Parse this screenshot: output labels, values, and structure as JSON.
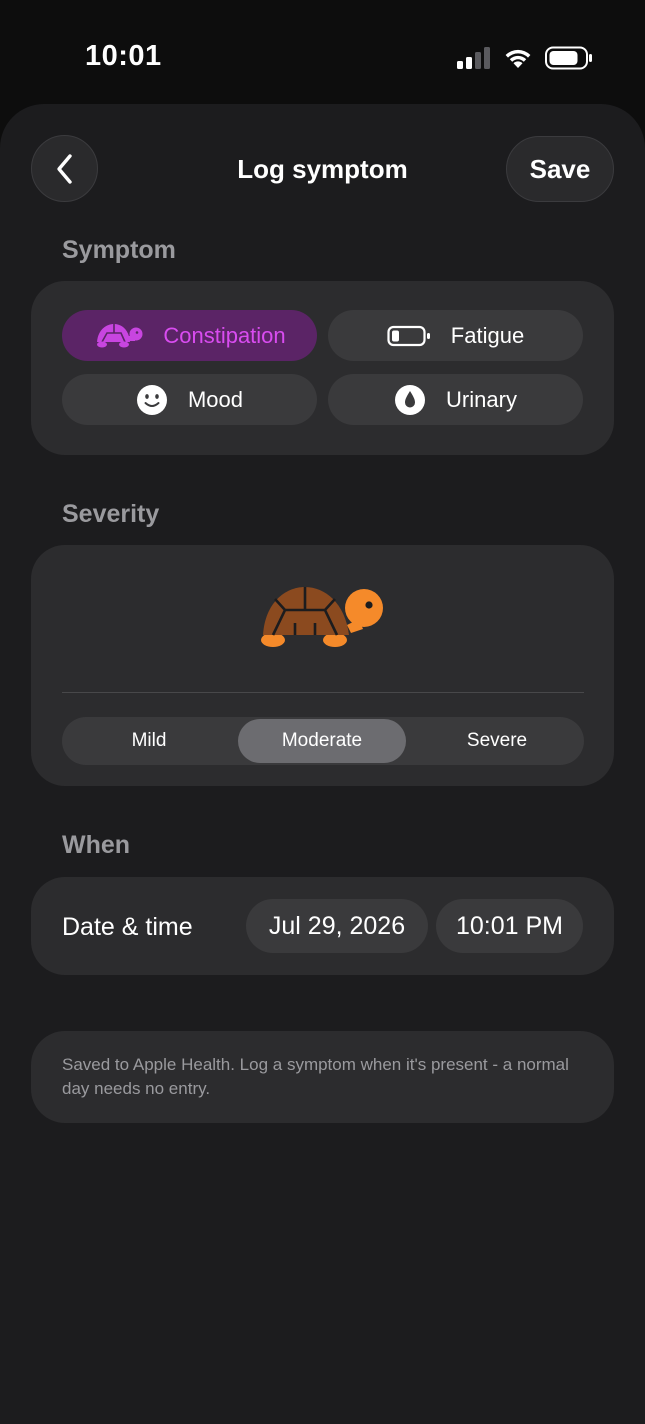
{
  "status_bar": {
    "time": "10:01"
  },
  "nav": {
    "title": "Log symptom",
    "save_label": "Save"
  },
  "symptom": {
    "section_label": "Symptom",
    "options": [
      {
        "label": "Constipation",
        "icon": "turtle-icon",
        "selected": true
      },
      {
        "label": "Fatigue",
        "icon": "battery-low-icon",
        "selected": false
      },
      {
        "label": "Mood",
        "icon": "smiley-icon",
        "selected": false
      },
      {
        "label": "Urinary",
        "icon": "droplet-icon",
        "selected": false
      }
    ]
  },
  "severity": {
    "section_label": "Severity",
    "icon": "turtle-icon",
    "options": [
      "Mild",
      "Moderate",
      "Severe"
    ],
    "selected": "Moderate"
  },
  "when": {
    "section_label": "When",
    "row_label": "Date & time",
    "date": "Jul 29, 2026",
    "time": "10:01 PM"
  },
  "note": "Saved to Apple Health. Log a symptom when it's present - a normal day needs no entry.",
  "colors": {
    "accent": "#d94cf0",
    "accent_bg": "#5b2466",
    "turtle_shell": "#8b4a1f",
    "turtle_body": "#f58a2a"
  }
}
